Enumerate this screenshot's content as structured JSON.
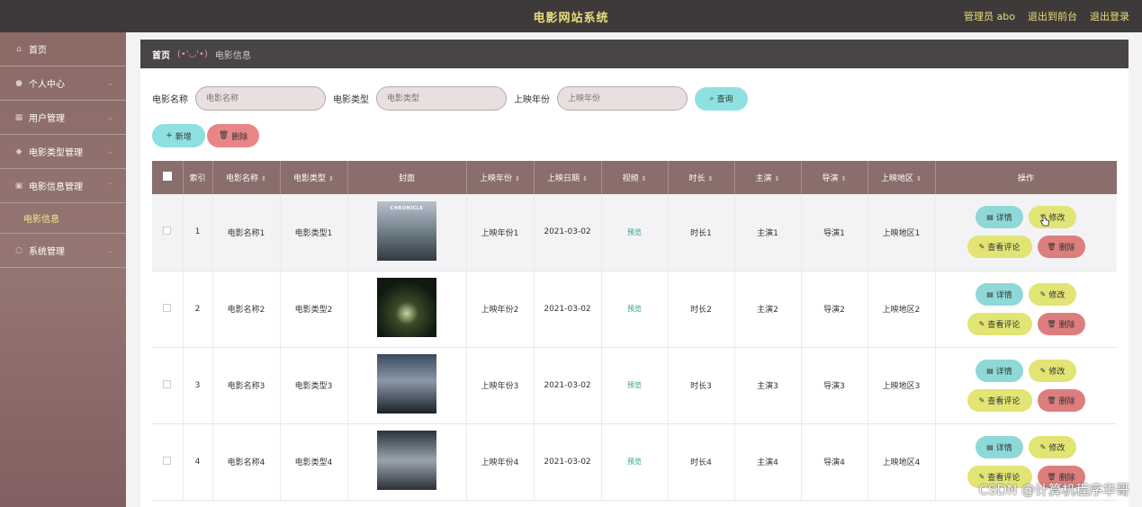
{
  "header": {
    "title": "电影网站系统",
    "user": "管理员 abo",
    "to_front": "退出到前台",
    "logout": "退出登录"
  },
  "sidebar": {
    "items": [
      {
        "label": "首页",
        "icon": "home-icon"
      },
      {
        "label": "个人中心",
        "icon": "user-icon"
      },
      {
        "label": "用户管理",
        "icon": "grid-icon"
      },
      {
        "label": "电影类型管理",
        "icon": "tag-icon"
      },
      {
        "label": "电影信息管理",
        "icon": "film-icon"
      },
      {
        "label": "系统管理",
        "icon": "gear-icon"
      }
    ],
    "active_sub": "电影信息"
  },
  "breadcrumb": {
    "home": "首页",
    "sep": "(•'◡'•)",
    "current": "电影信息"
  },
  "search": {
    "name_label": "电影名称",
    "name_placeholder": "电影名称",
    "type_label": "电影类型",
    "type_placeholder": "电影类型",
    "year_label": "上映年份",
    "year_placeholder": "上映年份",
    "query_label": "查询"
  },
  "actions": {
    "add_label": "新增",
    "delete_label": "删除"
  },
  "table": {
    "headers": [
      "索引",
      "电影名称",
      "电影类型",
      "封面",
      "上映年份",
      "上映日期",
      "视频",
      "时长",
      "主演",
      "导演",
      "上映地区",
      "操作"
    ],
    "rows": [
      {
        "index": "1",
        "name": "电影名称1",
        "type": "电影类型1",
        "cover": "CHRONICLE",
        "year": "上映年份1",
        "date": "2021-03-02",
        "video": "预览",
        "duration": "时长1",
        "actor": "主演1",
        "director": "导演1",
        "region": "上映地区1"
      },
      {
        "index": "2",
        "name": "电影名称2",
        "type": "电影类型2",
        "cover": "",
        "year": "上映年份2",
        "date": "2021-03-02",
        "video": "预览",
        "duration": "时长2",
        "actor": "主演2",
        "director": "导演2",
        "region": "上映地区2"
      },
      {
        "index": "3",
        "name": "电影名称3",
        "type": "电影类型3",
        "cover": "",
        "year": "上映年份3",
        "date": "2021-03-02",
        "video": "预览",
        "duration": "时长3",
        "actor": "主演3",
        "director": "导演3",
        "region": "上映地区3"
      },
      {
        "index": "4",
        "name": "电影名称4",
        "type": "电影类型4",
        "cover": "",
        "year": "上映年份4",
        "date": "2021-03-02",
        "video": "预览",
        "duration": "时长4",
        "actor": "主演4",
        "director": "导演4",
        "region": "上映地区4"
      }
    ],
    "op_detail": "详情",
    "op_edit": "修改",
    "op_comment": "查看评论",
    "op_delete": "删除"
  },
  "watermark": "CSDN @计算机程序华哥"
}
